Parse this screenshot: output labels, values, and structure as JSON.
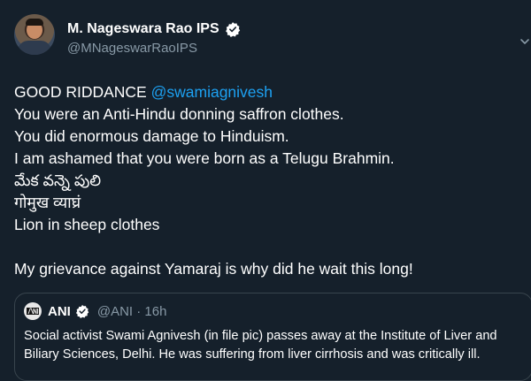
{
  "tweet": {
    "author": {
      "display_name": "M. Nageswara Rao IPS",
      "handle": "@MNageswarRaoIPS",
      "verified": true
    },
    "text": {
      "line1_prefix": "GOOD RIDDANCE ",
      "line1_mention": "@swamiagnivesh",
      "line2": "You were an Anti-Hindu donning saffron clothes.",
      "line3": "You did enormous damage to Hinduism.",
      "line4": "I am ashamed that you were born as a Telugu Brahmin.",
      "line5": "మేక వన్నె పులి",
      "line6": "गोमुख व्याघ्रं",
      "line7": "Lion in sheep clothes",
      "line8": "My grievance against Yamaraj is why did he wait this long!"
    },
    "quoted": {
      "display_name": "ANI",
      "verified": true,
      "handle_time": "@ANI · 16h",
      "text_line1": "Social activist Swami Agnivesh (in file pic) passes away at the Institute of Liver and",
      "text_line2": "Biliary Sciences, Delhi. He was suffering from liver cirrhosis and was critically ill."
    }
  },
  "colors": {
    "background": "#15202b",
    "text": "#ffffff",
    "secondary": "#8899a6",
    "mention": "#1da1f2",
    "border": "#38444d"
  },
  "icons": [
    "verified-badge-icon",
    "chevron-down-icon",
    "ani-logo-icon"
  ]
}
